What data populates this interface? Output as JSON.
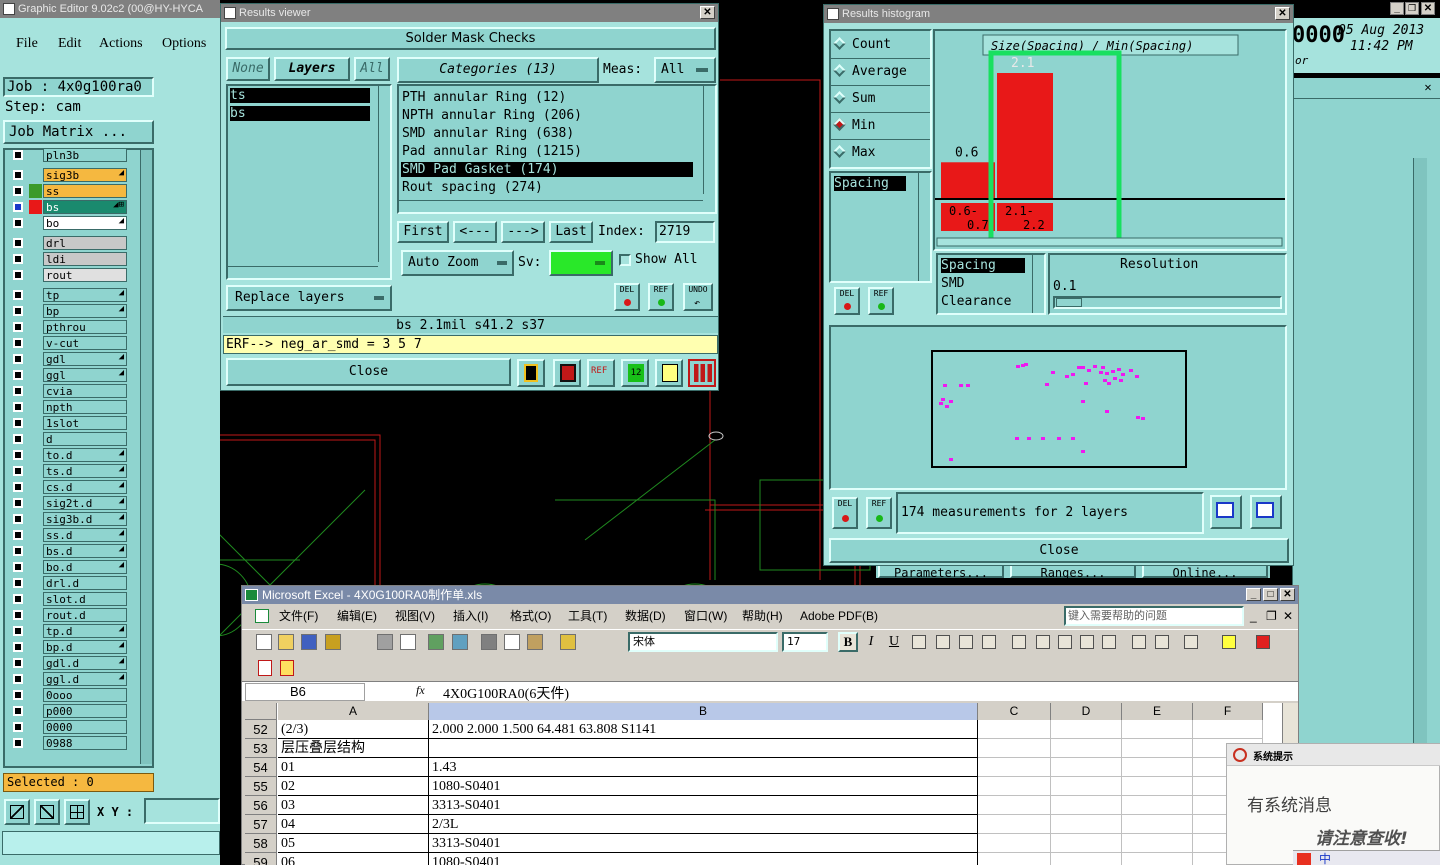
{
  "graphic_editor": {
    "title": "Graphic Editor 9.02c2 (00@HY-HYCA",
    "menu": [
      "File",
      "Edit",
      "Actions",
      "Options"
    ],
    "job": "Job  : 4x0g100ra0",
    "step": "Step: cam",
    "job_matrix": "Job Matrix ...",
    "selected": "Selected : 0",
    "xy_label": "X Y :"
  },
  "layers": [
    {
      "name": "pln3b",
      "color": "#8fd4cf"
    },
    {
      "name": "sig3b",
      "color": "#f5b840",
      "dot": "◢"
    },
    {
      "name": "ss",
      "color": "#f5b840",
      "swatch": "#3c9a2a"
    },
    {
      "name": "bs",
      "color": "#1a8a6e",
      "swatch": "#e81818",
      "dot": "◢⊞",
      "active": true
    },
    {
      "name": "bo",
      "color": "#ffffff",
      "dot": "◢"
    },
    {
      "name": "drl",
      "color": "#c8c8c8"
    },
    {
      "name": "ldi",
      "color": "#c8c8c8"
    },
    {
      "name": "rout",
      "color": "#e0e0e0"
    },
    {
      "name": "tp",
      "color": "#8fd4cf",
      "dot": "◢"
    },
    {
      "name": "bp",
      "color": "#8fd4cf",
      "dot": "◢"
    },
    {
      "name": "pthrou",
      "color": "#8fd4cf"
    },
    {
      "name": "v-cut",
      "color": "#8fd4cf"
    },
    {
      "name": "gdl",
      "color": "#8fd4cf",
      "dot": "◢"
    },
    {
      "name": "ggl",
      "color": "#8fd4cf",
      "dot": "◢"
    },
    {
      "name": "cvia",
      "color": "#8fd4cf"
    },
    {
      "name": "npth",
      "color": "#8fd4cf"
    },
    {
      "name": "1slot",
      "color": "#8fd4cf"
    },
    {
      "name": "d",
      "color": "#8fd4cf"
    },
    {
      "name": "to.d",
      "color": "#8fd4cf",
      "dot": "◢"
    },
    {
      "name": "ts.d",
      "color": "#8fd4cf",
      "dot": "◢"
    },
    {
      "name": "cs.d",
      "color": "#8fd4cf",
      "dot": "◢"
    },
    {
      "name": "sig2t.d",
      "color": "#8fd4cf",
      "dot": "◢"
    },
    {
      "name": "sig3b.d",
      "color": "#8fd4cf",
      "dot": "◢"
    },
    {
      "name": "ss.d",
      "color": "#8fd4cf",
      "dot": "◢"
    },
    {
      "name": "bs.d",
      "color": "#8fd4cf",
      "dot": "◢"
    },
    {
      "name": "bo.d",
      "color": "#8fd4cf",
      "dot": "◢"
    },
    {
      "name": "drl.d",
      "color": "#8fd4cf"
    },
    {
      "name": "slot.d",
      "color": "#8fd4cf"
    },
    {
      "name": "rout.d",
      "color": "#8fd4cf"
    },
    {
      "name": "tp.d",
      "color": "#8fd4cf",
      "dot": "◢"
    },
    {
      "name": "bp.d",
      "color": "#8fd4cf",
      "dot": "◢"
    },
    {
      "name": "gdl.d",
      "color": "#8fd4cf",
      "dot": "◢"
    },
    {
      "name": "ggl.d",
      "color": "#8fd4cf",
      "dot": "◢"
    },
    {
      "name": "0ooo",
      "color": "#8fd4cf"
    },
    {
      "name": "p000",
      "color": "#8fd4cf"
    },
    {
      "name": "0000",
      "color": "#8fd4cf"
    },
    {
      "name": "0988",
      "color": "#8fd4cf"
    }
  ],
  "results_viewer": {
    "title": "Results viewer",
    "header": "Solder Mask Checks",
    "none": "None",
    "layers_btn": "Layers",
    "all_btn": "All",
    "layer_list": [
      "ts",
      "bs"
    ],
    "categories": "Categories (13)",
    "meas_label": "Meas:",
    "meas_value": "All",
    "category_list": [
      "PTH annular Ring (12)",
      "NPTH annular Ring (206)",
      "SMD annular Ring (638)",
      "Pad annular Ring (1215)",
      "SMD Pad Gasket (174)",
      "Rout spacing (274)"
    ],
    "first": "First",
    "prev": "<---",
    "next": "--->",
    "last": "Last",
    "index_label": "Index:",
    "index_value": "2719",
    "auto_zoom": "Auto Zoom",
    "sv_label": "Sv:",
    "show_all": "Show All",
    "replace_layers": "Replace layers",
    "del": "DEL",
    "ref": "REF",
    "undo": "UNDO",
    "status": "bs 2.1mil  s41.2  s37",
    "erf": "ERF--> neg_ar_smd = 3 5 7",
    "close": "Close"
  },
  "histogram": {
    "title": "Results histogram",
    "stats": [
      "Count",
      "Average",
      "Sum",
      "Min",
      "Max"
    ],
    "selected_stat": "Min",
    "chart_title": "Size(Spacing) / Min(Spacing)",
    "measure_list": [
      "Spacing"
    ],
    "types": [
      "Spacing",
      "SMD",
      "Clearance"
    ],
    "resolution_label": "Resolution",
    "resolution_value": "0.1",
    "del": "DEL",
    "ref": "REF",
    "summary": "174 measurements for 2 layers",
    "close": "Close",
    "under_buttons": [
      "Parameters...",
      "Ranges...",
      "Online..."
    ]
  },
  "chart_data": {
    "type": "bar",
    "categories": [
      "0.6-0.7",
      "2.1-2.2"
    ],
    "values": [
      0.6,
      2.1
    ],
    "title": "Size(Spacing) / Min(Spacing)",
    "data_labels": [
      "0.6",
      "2.1"
    ]
  },
  "clock": {
    "digits": "0000",
    "date": "05 Aug 2013",
    "time": "11:42 PM",
    "small": "or"
  },
  "excel": {
    "title": "Microsoft Excel - 4X0G100RA0制作单.xls",
    "menus": [
      "文件(F)",
      "编辑(E)",
      "视图(V)",
      "插入(I)",
      "格式(O)",
      "工具(T)",
      "数据(D)",
      "窗口(W)",
      "帮助(H)",
      "Adobe PDF(B)"
    ],
    "help_placeholder": "键入需要帮助的问题",
    "font": "宋体",
    "font_size": "17",
    "cell_ref": "B6",
    "fx": "fx",
    "formula": "4X0G100RA0(6天件)",
    "columns": [
      "A",
      "B",
      "C",
      "D",
      "E",
      "F"
    ],
    "rows": [
      {
        "n": "52",
        "a": "(2/3)",
        "b": "2.000   2.000    1.500                    64.481     63.808        S1141"
      },
      {
        "n": "53",
        "a": "层压叠层结构",
        "b": ""
      },
      {
        "n": "54",
        "a": "01",
        "b": "1.43"
      },
      {
        "n": "55",
        "a": "02",
        "b": "1080-S0401"
      },
      {
        "n": "56",
        "a": "03",
        "b": "3313-S0401"
      },
      {
        "n": "57",
        "a": "04",
        "b": "2/3L"
      },
      {
        "n": "58",
        "a": "05",
        "b": "3313-S0401"
      },
      {
        "n": "59",
        "a": "06",
        "b": "1080-S0401"
      }
    ]
  },
  "popup": {
    "title": "系统提示",
    "line1": "有系统消息",
    "line2": "请注意查收!",
    "ime": "中"
  }
}
